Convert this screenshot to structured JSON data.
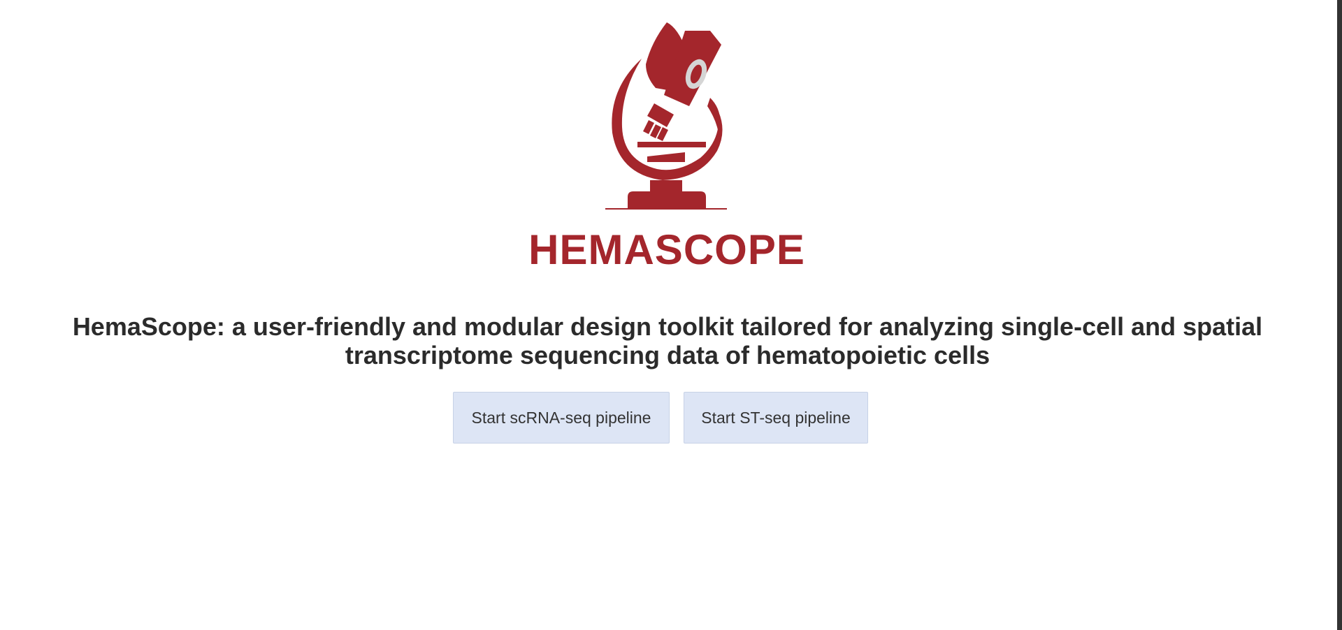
{
  "logo": {
    "icon": "microscope-icon",
    "wordmark": "HEMASCOPE",
    "color": "#a4262c"
  },
  "headline": "HemaScope: a user-friendly and modular design toolkit tailored for analyzing single-cell and spatial transcriptome sequencing data of hematopoietic cells",
  "buttons": {
    "scrna_label": "Start scRNA-seq pipeline",
    "st_label": "Start ST-seq pipeline",
    "background": "#dde5f5"
  }
}
